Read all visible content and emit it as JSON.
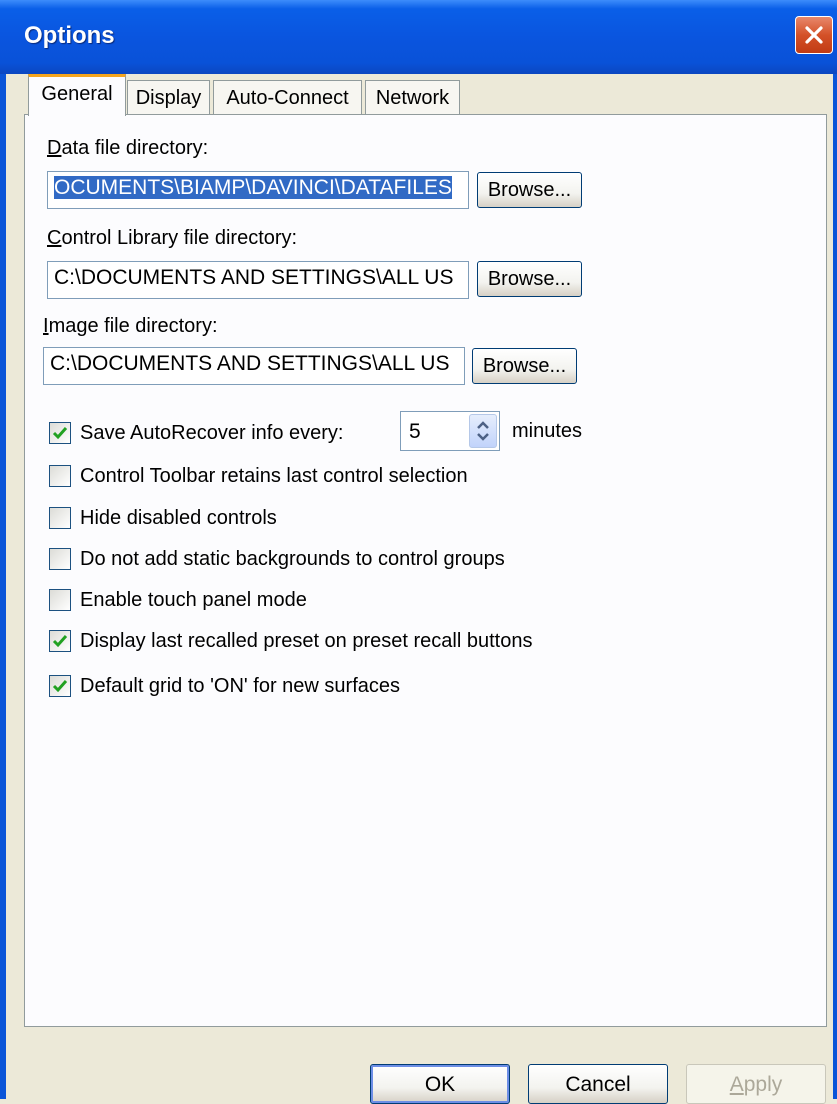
{
  "window": {
    "title": "Options"
  },
  "tabs": [
    {
      "label": "General"
    },
    {
      "label": "Display"
    },
    {
      "label": "Auto-Connect"
    },
    {
      "label": "Network"
    }
  ],
  "fields": {
    "data_dir": {
      "label_first": "D",
      "label_rest": "ata file directory:",
      "value": "OCUMENTS\\BIAMP\\DAVINCI\\DATAFILES",
      "browse": "Browse..."
    },
    "control_lib_dir": {
      "label_first": "C",
      "label_rest": "ontrol Library file directory:",
      "value": "C:\\DOCUMENTS AND SETTINGS\\ALL US",
      "browse": "Browse..."
    },
    "image_dir": {
      "label_first": "I",
      "label_rest": "mage file directory:",
      "value": "C:\\DOCUMENTS AND SETTINGS\\ALL US",
      "browse": "Browse..."
    }
  },
  "autorecover": {
    "label": "Save AutoRecover info every:",
    "value": "5",
    "unit": "minutes",
    "checked": true
  },
  "options": [
    {
      "label": "Control Toolbar retains last control selection",
      "checked": false
    },
    {
      "label": "Hide disabled controls",
      "checked": false
    },
    {
      "label": "Do not add static backgrounds to control groups",
      "checked": false
    },
    {
      "label": "Enable touch panel mode",
      "checked": false
    },
    {
      "label": "Display last recalled preset on preset recall buttons",
      "checked": true
    },
    {
      "label": "Default grid to 'ON' for new surfaces",
      "checked": true
    }
  ],
  "buttons": {
    "ok": "OK",
    "cancel": "Cancel",
    "apply_first": "A",
    "apply_rest": "pply"
  },
  "colors": {
    "title_bar": "#0a55df",
    "selection": "#316ac5",
    "check": "#21a121",
    "tab_highlight": "#f5a51e"
  },
  "icons": {
    "close": "close-icon",
    "check": "check-icon",
    "spin": "spin-arrows-icon"
  }
}
